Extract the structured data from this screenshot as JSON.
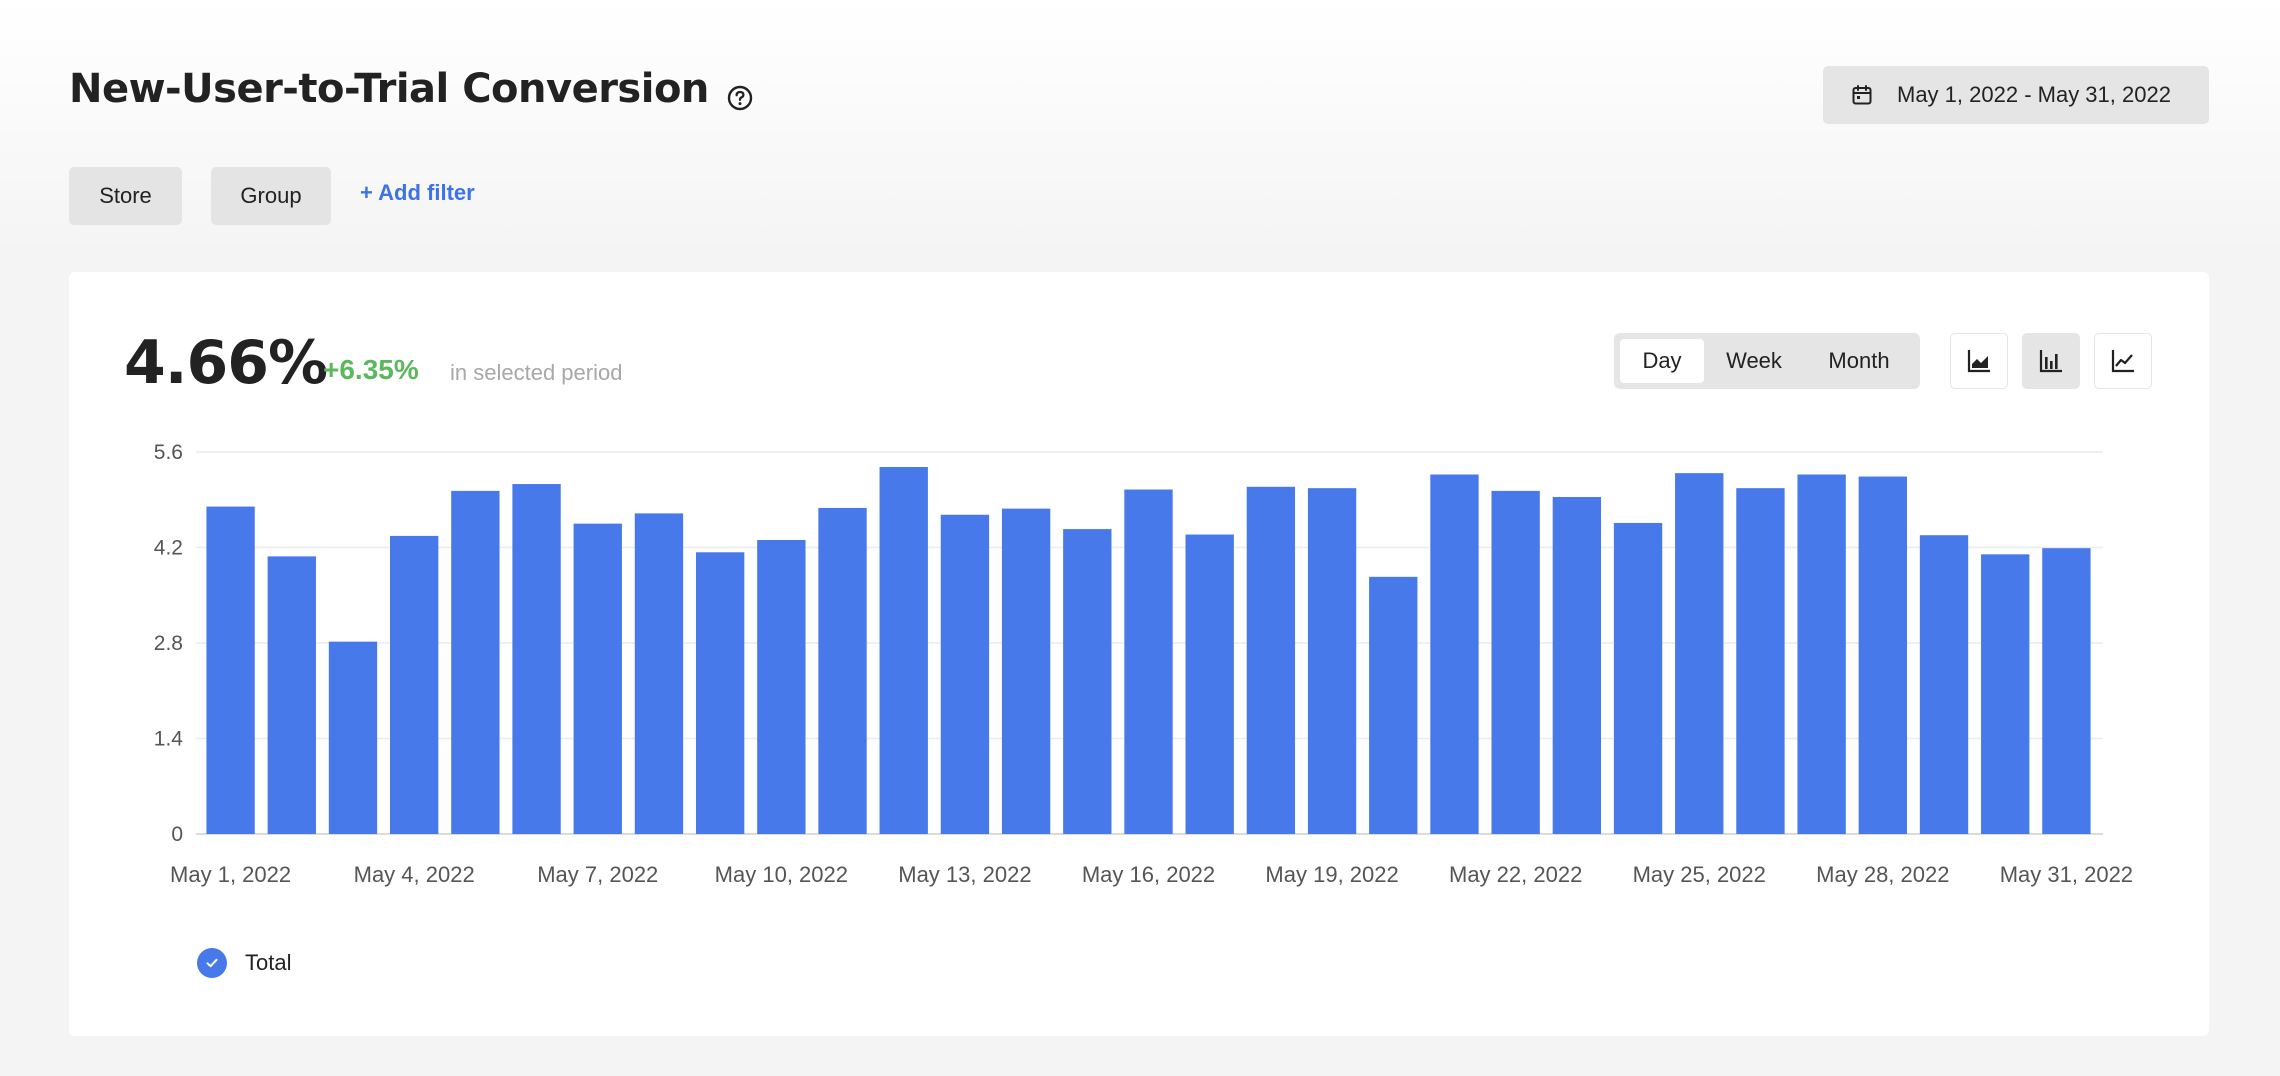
{
  "header": {
    "title": "New-User-to-Trial Conversion",
    "date_range": "May 1, 2022 - May 31, 2022"
  },
  "filters": {
    "store_label": "Store",
    "group_label": "Group",
    "add_filter_label": "+ Add filter"
  },
  "summary": {
    "value": "4.66%",
    "delta": "+6.35%",
    "note": "in selected period"
  },
  "granularity": {
    "options": [
      "Day",
      "Week",
      "Month"
    ],
    "selected": "Day"
  },
  "chart_types": {
    "options": [
      "area-chart-icon",
      "bar-chart-icon",
      "line-chart-icon"
    ],
    "selected": "bar-chart-icon"
  },
  "colors": {
    "bar": "#4779ea",
    "delta_positive": "#5cb85c",
    "link": "#3d73e6"
  },
  "legend": {
    "items": [
      {
        "label": "Total",
        "checked": true
      }
    ]
  },
  "chart_data": {
    "type": "bar",
    "categories": [
      "May 1, 2022",
      "May 2, 2022",
      "May 3, 2022",
      "May 4, 2022",
      "May 5, 2022",
      "May 6, 2022",
      "May 7, 2022",
      "May 8, 2022",
      "May 9, 2022",
      "May 10, 2022",
      "May 11, 2022",
      "May 12, 2022",
      "May 13, 2022",
      "May 14, 2022",
      "May 15, 2022",
      "May 16, 2022",
      "May 17, 2022",
      "May 18, 2022",
      "May 19, 2022",
      "May 20, 2022",
      "May 21, 2022",
      "May 22, 2022",
      "May 23, 2022",
      "May 24, 2022",
      "May 25, 2022",
      "May 26, 2022",
      "May 27, 2022",
      "May 28, 2022",
      "May 29, 2022",
      "May 30, 2022",
      "May 31, 2022"
    ],
    "x_tick_labels": [
      "May 1, 2022",
      "May 4, 2022",
      "May 7, 2022",
      "May 10, 2022",
      "May 13, 2022",
      "May 16, 2022",
      "May 19, 2022",
      "May 22, 2022",
      "May 25, 2022",
      "May 28, 2022",
      "May 31, 2022"
    ],
    "series": [
      {
        "name": "Total",
        "values": [
          4.8,
          4.07,
          2.82,
          4.37,
          5.03,
          5.13,
          4.55,
          4.7,
          4.13,
          4.31,
          4.78,
          5.38,
          4.68,
          4.77,
          4.47,
          5.05,
          4.39,
          5.09,
          5.07,
          3.77,
          5.27,
          5.03,
          4.94,
          4.56,
          5.29,
          5.07,
          5.27,
          5.24,
          4.38,
          4.1,
          4.19
        ]
      }
    ],
    "yticks": [
      0,
      1.4,
      2.8,
      4.2,
      5.6
    ],
    "ylim": [
      0,
      5.6
    ],
    "grid": true,
    "legend_position": "bottom-left"
  }
}
